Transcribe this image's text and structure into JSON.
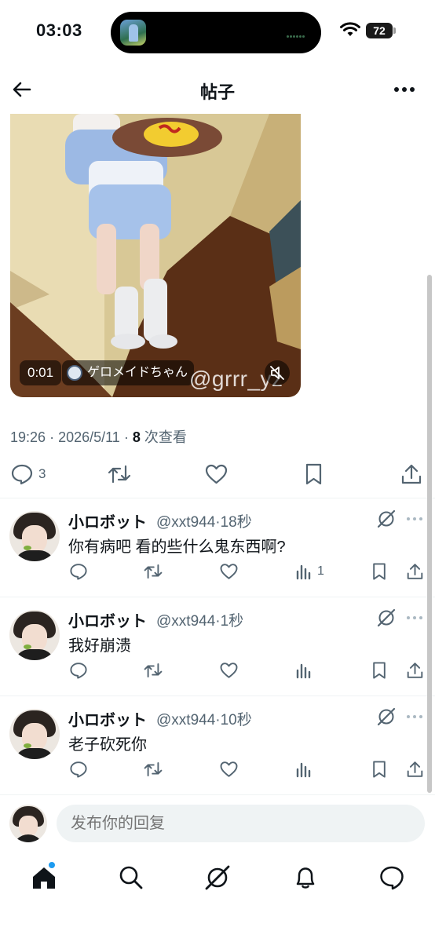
{
  "status_bar": {
    "time": "03:03",
    "battery": "72"
  },
  "header": {
    "title": "帖子"
  },
  "video": {
    "elapsed": "0:01",
    "author": "ゲロメイドちゃん",
    "watermark": "@grrr_yz"
  },
  "post_meta": {
    "time": "19:26",
    "date": "2026/5/11",
    "separator": "·",
    "views_count": "8",
    "views_label": "次查看"
  },
  "actions": {
    "reply_count": "3"
  },
  "replies": [
    {
      "name": "小ロボット",
      "handle": "@xxt944",
      "time": "18秒",
      "text": "你有病吧 看的些什么鬼东西啊?",
      "views": "1"
    },
    {
      "name": "小ロボット",
      "handle": "@xxt944",
      "time": "1秒",
      "text": "我好崩溃",
      "views": ""
    },
    {
      "name": "小ロボット",
      "handle": "@xxt944",
      "time": "10秒",
      "text": "老子砍死你",
      "views": ""
    }
  ],
  "composer": {
    "placeholder": "发布你的回复"
  },
  "colors": {
    "accent": "#1d9bf0",
    "text": "#0f1419",
    "muted": "#536471"
  },
  "icons": [
    "back-icon",
    "more-icon",
    "reply-icon",
    "repost-icon",
    "like-icon",
    "bookmark-icon",
    "share-icon",
    "views-icon",
    "grok-icon",
    "home-icon",
    "search-icon",
    "notifications-icon",
    "messages-icon"
  ]
}
